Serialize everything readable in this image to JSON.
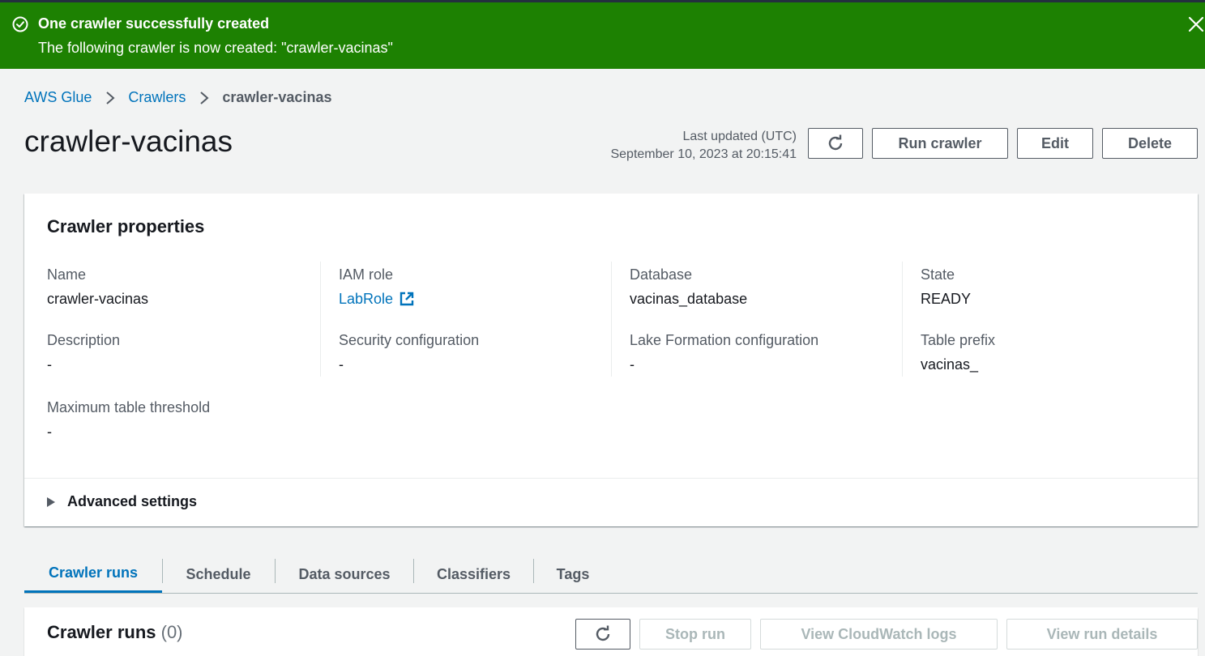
{
  "flash": {
    "title": "One crawler successfully created",
    "message": "The following crawler is now created: \"crawler-vacinas\"",
    "status_color": "#1d8102"
  },
  "breadcrumb": {
    "items": [
      {
        "label": "AWS Glue"
      },
      {
        "label": "Crawlers"
      },
      {
        "label": "crawler-vacinas"
      }
    ]
  },
  "page": {
    "title": "crawler-vacinas",
    "last_updated_label": "Last updated (UTC)",
    "last_updated_value": "September 10, 2023 at 20:15:41"
  },
  "actions": {
    "run_label": "Run crawler",
    "edit_label": "Edit",
    "delete_label": "Delete"
  },
  "properties": {
    "title": "Crawler properties",
    "name": {
      "label": "Name",
      "value": "crawler-vacinas"
    },
    "iam_role": {
      "label": "IAM role",
      "value": "LabRole"
    },
    "database": {
      "label": "Database",
      "value": "vacinas_database"
    },
    "state": {
      "label": "State",
      "value": "READY"
    },
    "description": {
      "label": "Description",
      "value": "-"
    },
    "security": {
      "label": "Security configuration",
      "value": "-"
    },
    "lake_formation": {
      "label": "Lake Formation configuration",
      "value": "-"
    },
    "table_prefix": {
      "label": "Table prefix",
      "value": "vacinas_"
    },
    "max_threshold": {
      "label": "Maximum table threshold",
      "value": "-"
    },
    "advanced_label": "Advanced settings"
  },
  "tabs": [
    {
      "label": "Crawler runs",
      "active": true
    },
    {
      "label": "Schedule"
    },
    {
      "label": "Data sources"
    },
    {
      "label": "Classifiers"
    },
    {
      "label": "Tags"
    }
  ],
  "runs": {
    "title": "Crawler runs",
    "count": "(0)",
    "stop_label": "Stop run",
    "cloudwatch_label": "View CloudWatch logs",
    "details_label": "View run details"
  },
  "colors": {
    "link": "#0073bb",
    "background": "#f2f3f3"
  }
}
